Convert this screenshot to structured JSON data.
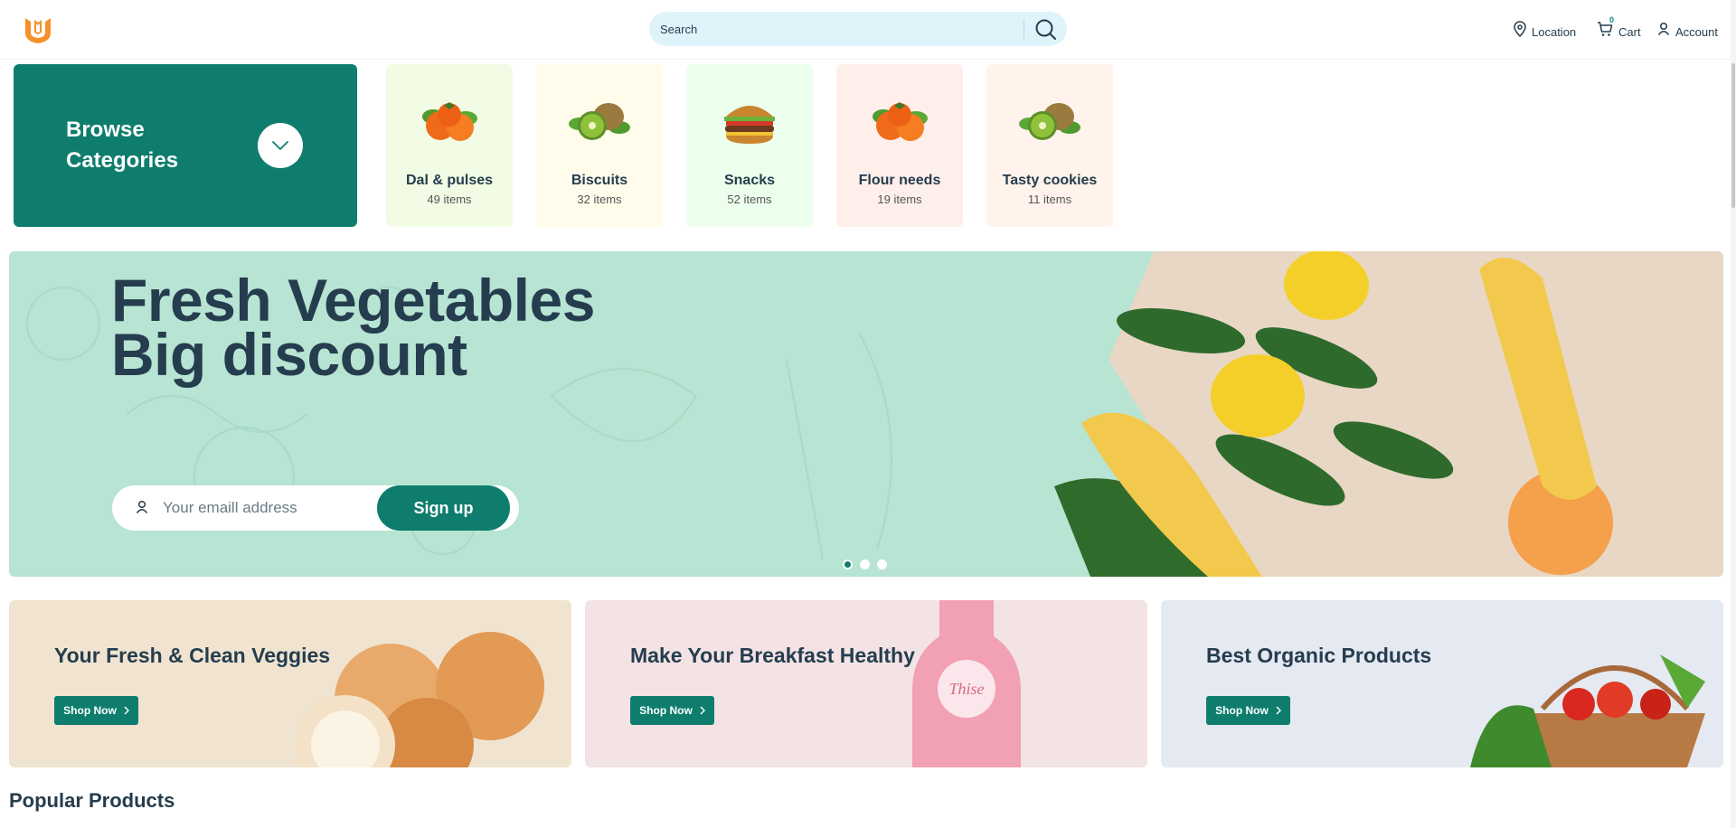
{
  "header": {
    "search_placeholder": "Search",
    "nav": {
      "location": "Location",
      "cart": "Cart",
      "cart_count": "0",
      "account": "Account"
    }
  },
  "browse": {
    "title": "Browse Categories"
  },
  "categories": [
    {
      "name": "Dal & pulses",
      "count": "49 items",
      "bg": "#f2fce4",
      "icon": "persimmon-icon"
    },
    {
      "name": "Biscuits",
      "count": "32 items",
      "bg": "#fffceb",
      "icon": "kiwi-icon"
    },
    {
      "name": "Snacks",
      "count": "52 items",
      "bg": "#ecffec",
      "icon": "burger-icon"
    },
    {
      "name": "Flour needs",
      "count": "19 items",
      "bg": "#feefea",
      "icon": "persimmon-icon"
    },
    {
      "name": "Tasty cookies",
      "count": "11 items",
      "bg": "#fff3eb",
      "icon": "kiwi-icon"
    }
  ],
  "hero": {
    "line1": "Fresh Vegetables",
    "line2": "Big discount",
    "email_placeholder": "Your emaill address",
    "signup": "Sign up",
    "active_slide": 1
  },
  "promos": [
    {
      "title": "Your Fresh & Clean Veggies",
      "button": "Shop Now",
      "bg": "#f0e4d0"
    },
    {
      "title": "Make Your Breakfast Healthy",
      "button": "Shop Now",
      "bg": "#f3e3e5"
    },
    {
      "title": "Best Organic Products",
      "button": "Shop Now",
      "bg": "#e5e9f1"
    }
  ],
  "popular": {
    "title": "Popular Products"
  },
  "colors": {
    "brand": "#0f7d6d",
    "logo": "#f59128",
    "text": "#253d4e",
    "hero_bg": "#b7e4d3"
  }
}
